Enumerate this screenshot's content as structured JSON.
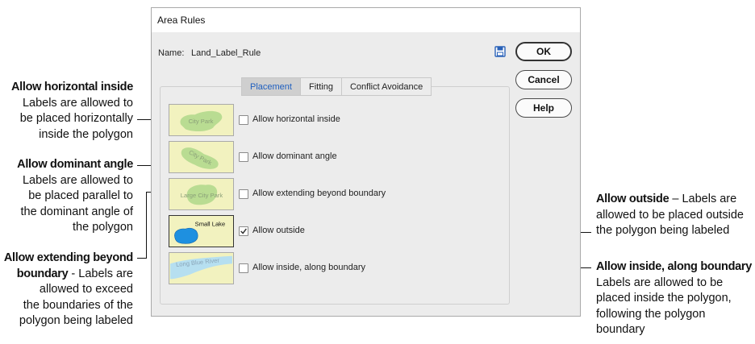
{
  "dialog": {
    "title": "Area Rules",
    "name_label": "Name:",
    "name_value": "Land_Label_Rule",
    "buttons": {
      "ok": "OK",
      "cancel": "Cancel",
      "help": "Help"
    },
    "tabs": [
      {
        "label": "Placement",
        "active": true
      },
      {
        "label": "Fitting",
        "active": false
      },
      {
        "label": "Conflict Avoidance",
        "active": false
      }
    ],
    "options": [
      {
        "label": "Allow horizontal inside",
        "checked": false,
        "thumb_text": "City Park"
      },
      {
        "label": "Allow dominant angle",
        "checked": false,
        "thumb_text": "City Park"
      },
      {
        "label": "Allow extending beyond boundary",
        "checked": false,
        "thumb_text": "Large City Park"
      },
      {
        "label": "Allow outside",
        "checked": true,
        "thumb_text": "Small Lake"
      },
      {
        "label": "Allow inside, along boundary",
        "checked": false,
        "thumb_text": "Long Blue River"
      }
    ]
  },
  "annotations": {
    "horizontal": {
      "title": "Allow horizontal inside",
      "lines": [
        "Labels are allowed to",
        "be placed horizontally",
        "inside the polygon"
      ]
    },
    "dominant": {
      "title": "Allow dominant angle",
      "lines": [
        "Labels are allowed to",
        "be placed parallel to",
        "the dominant angle of",
        "the polygon"
      ]
    },
    "extending": {
      "title_1": "Allow extending beyond",
      "title_2": "boundary",
      "title_2_rest": " - Labels are",
      "lines": [
        "allowed to exceed",
        "the boundaries of the",
        "polygon being labeled"
      ]
    },
    "outside": {
      "title": "Allow outside",
      "title_rest": " – Labels are",
      "lines": [
        "allowed to be placed outside",
        "the polygon being labeled"
      ]
    },
    "along": {
      "title": "Allow inside, along boundary",
      "lines": [
        "Labels are allowed to be",
        "placed inside the polygon,",
        "following the polygon",
        "boundary"
      ]
    }
  },
  "colors": {
    "park_green": "#b9dc92",
    "park_text": "#8a9f78",
    "lake_blue": "#1e90e0",
    "river_blue": "#b6dff0",
    "thumb_bg": "#f2f2bf",
    "active_tab_text": "#1f5fbf"
  }
}
